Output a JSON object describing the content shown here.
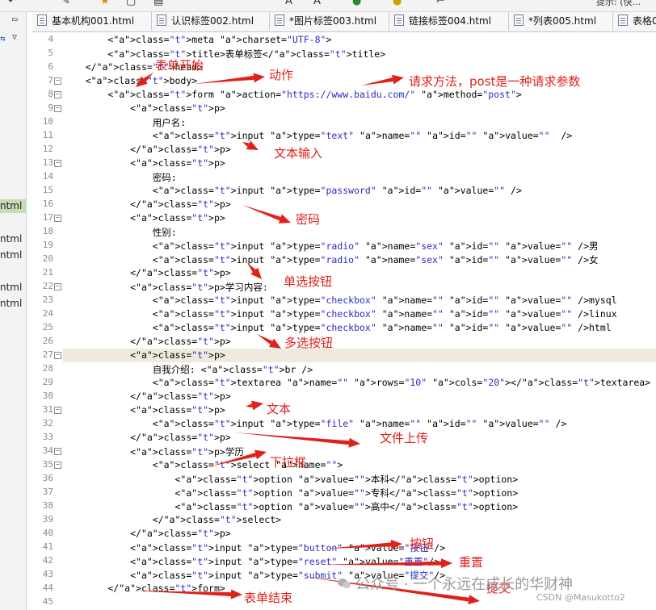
{
  "editor": {
    "top_right_field": "提示: (快..."
  },
  "tabs": [
    {
      "label": "基本机构001.html"
    },
    {
      "label": "认识标签002.html"
    },
    {
      "label": "*图片标签003.html"
    },
    {
      "label": "链接标签004.html"
    },
    {
      "label": "*列表005.html"
    },
    {
      "label": "表格0"
    }
  ],
  "sidebar": {
    "items": [
      {
        "label": "ntml",
        "selected": true
      },
      {
        "label": "ntml",
        "selected": false
      },
      {
        "label": "ntml",
        "selected": false
      },
      {
        "label": "ntml",
        "selected": false
      },
      {
        "label": "ntml",
        "selected": false
      }
    ]
  },
  "code": {
    "current_line": 27,
    "lines": [
      {
        "n": "4",
        "text": "        <meta charset=\"UTF-8\">"
      },
      {
        "n": "5",
        "text": "        <title>表单标签</title>"
      },
      {
        "n": "6",
        "text": "    </head>"
      },
      {
        "n": "7",
        "text": "    <body>"
      },
      {
        "n": "8",
        "text": "        <form action=\"https://www.baidu.com/\" method=\"post\">"
      },
      {
        "n": "9",
        "text": "            <p>"
      },
      {
        "n": "10",
        "text": "                用户名:"
      },
      {
        "n": "11",
        "text": "                <input type=\"text\" name=\"\" id=\"\" value=\"\"  />"
      },
      {
        "n": "12",
        "text": "            </p>"
      },
      {
        "n": "13",
        "text": "            <p>"
      },
      {
        "n": "14",
        "text": "                密码:"
      },
      {
        "n": "15",
        "text": "                <input type=\"password\" id=\"\" value=\"\" />"
      },
      {
        "n": "16",
        "text": "            </p>"
      },
      {
        "n": "17",
        "text": "            <p>"
      },
      {
        "n": "18",
        "text": "                性别:"
      },
      {
        "n": "19",
        "text": "                <input type=\"radio\" name=\"sex\" id=\"\" value=\"\" />男"
      },
      {
        "n": "20",
        "text": "                <input type=\"radio\" name=\"sex\" id=\"\" value=\"\" />女"
      },
      {
        "n": "21",
        "text": "            </p>"
      },
      {
        "n": "22",
        "text": "            <p>学习内容:"
      },
      {
        "n": "23",
        "text": "                <input type=\"checkbox\" name=\"\" id=\"\" value=\"\" />mysql"
      },
      {
        "n": "24",
        "text": "                <input type=\"checkbox\" name=\"\" id=\"\" value=\"\" />linux"
      },
      {
        "n": "25",
        "text": "                <input type=\"checkbox\" name=\"\" id=\"\" value=\"\" />html"
      },
      {
        "n": "26",
        "text": "            </p>"
      },
      {
        "n": "27",
        "text": "            <p>"
      },
      {
        "n": "28",
        "text": "                自我介绍: <br />"
      },
      {
        "n": "29",
        "text": "                <textarea name=\"\" rows=\"10\" cols=\"20\"></textarea>"
      },
      {
        "n": "30",
        "text": "            </p>"
      },
      {
        "n": "31",
        "text": "            <p>"
      },
      {
        "n": "32",
        "text": "                <input type=\"file\" name=\"\" id=\"\" value=\"\" />"
      },
      {
        "n": "33",
        "text": "            </p>"
      },
      {
        "n": "34",
        "text": "            <p>学历"
      },
      {
        "n": "35",
        "text": "                <select name=\"\">"
      },
      {
        "n": "36",
        "text": "                    <option value=\"\">本科</option>"
      },
      {
        "n": "37",
        "text": "                    <option value=\"\">专科</option>"
      },
      {
        "n": "38",
        "text": "                    <option value=\"\">高中</option>"
      },
      {
        "n": "39",
        "text": "                </select>"
      },
      {
        "n": "40",
        "text": "            </p>"
      },
      {
        "n": "41",
        "text": "            <input type=\"button\" value=\"按钮\"/>"
      },
      {
        "n": "42",
        "text": "            <input type=\"reset\" value=\"重置\"/>"
      },
      {
        "n": "43",
        "text": "            <input type=\"submit\" value=\"提交\"/>"
      },
      {
        "n": "44",
        "text": "        </form>"
      },
      {
        "n": "45",
        "text": ""
      }
    ],
    "fold_lines": [
      "7",
      "8",
      "9",
      "13",
      "17",
      "22",
      "27",
      "31",
      "34",
      "35"
    ]
  },
  "annotations": {
    "form_start": "表单开始",
    "action": "动作",
    "method": "请求方法，post是一种请求参数",
    "text_input": "文本输入",
    "password": "密码",
    "radio": "单选按钮",
    "checkbox": "多选按钮",
    "textarea": "文本",
    "file_upload": "文件上传",
    "select": "下拉框",
    "button": "按钮",
    "reset": "重置",
    "submit": "提交",
    "form_end": "表单结束",
    "color": "#e0201a"
  },
  "watermark": {
    "text": "公众号 · 一个永远在成长的华财神",
    "credit": "CSDN @Masukotto2"
  }
}
